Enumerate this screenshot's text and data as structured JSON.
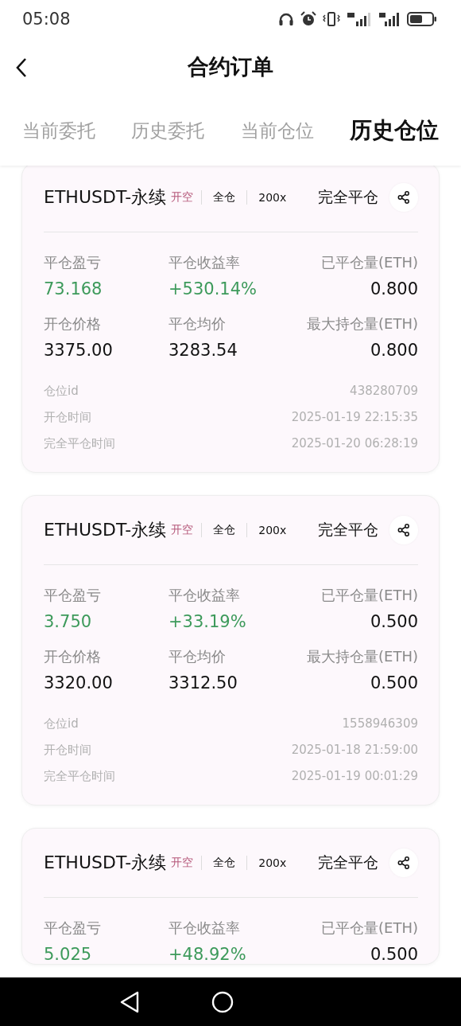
{
  "status_bar": {
    "time": "05:08"
  },
  "header": {
    "title": "合约订单"
  },
  "tabs": [
    {
      "label": "当前委托",
      "selected": false
    },
    {
      "label": "历史委托",
      "selected": false
    },
    {
      "label": "当前仓位",
      "selected": false
    },
    {
      "label": "历史仓位",
      "selected": true
    }
  ],
  "positions": [
    {
      "symbol": "ETHUSDT-永续",
      "side": "开空",
      "margin_mode": "全仓",
      "leverage": "200x",
      "status": "完全平仓",
      "stats": [
        {
          "label": "平仓盈亏",
          "value": "73.168",
          "positive": true
        },
        {
          "label": "平仓收益率",
          "value": "+530.14%",
          "positive": true
        },
        {
          "label": "已平仓量(ETH)",
          "value": "0.800",
          "positive": false
        },
        {
          "label": "开仓价格",
          "value": "3375.00",
          "positive": false
        },
        {
          "label": "平仓均价",
          "value": "3283.54",
          "positive": false
        },
        {
          "label": "最大持仓量(ETH)",
          "value": "0.800",
          "positive": false
        }
      ],
      "details": [
        {
          "label": "仓位id",
          "value": "438280709"
        },
        {
          "label": "开仓时间",
          "value": "2025-01-19 22:15:35"
        },
        {
          "label": "完全平仓时间",
          "value": "2025-01-20 06:28:19"
        }
      ]
    },
    {
      "symbol": "ETHUSDT-永续",
      "side": "开空",
      "margin_mode": "全仓",
      "leverage": "200x",
      "status": "完全平仓",
      "stats": [
        {
          "label": "平仓盈亏",
          "value": "3.750",
          "positive": true
        },
        {
          "label": "平仓收益率",
          "value": "+33.19%",
          "positive": true
        },
        {
          "label": "已平仓量(ETH)",
          "value": "0.500",
          "positive": false
        },
        {
          "label": "开仓价格",
          "value": "3320.00",
          "positive": false
        },
        {
          "label": "平仓均价",
          "value": "3312.50",
          "positive": false
        },
        {
          "label": "最大持仓量(ETH)",
          "value": "0.500",
          "positive": false
        }
      ],
      "details": [
        {
          "label": "仓位id",
          "value": "1558946309"
        },
        {
          "label": "开仓时间",
          "value": "2025-01-18 21:59:00"
        },
        {
          "label": "完全平仓时间",
          "value": "2025-01-19 00:01:29"
        }
      ]
    },
    {
      "symbol": "ETHUSDT-永续",
      "side": "开空",
      "margin_mode": "全仓",
      "leverage": "200x",
      "status": "完全平仓",
      "stats": [
        {
          "label": "平仓盈亏",
          "value": "5.025",
          "positive": true
        },
        {
          "label": "平仓收益率",
          "value": "+48.92%",
          "positive": true
        },
        {
          "label": "已平仓量(ETH)",
          "value": "0.500",
          "positive": false
        }
      ]
    }
  ]
}
